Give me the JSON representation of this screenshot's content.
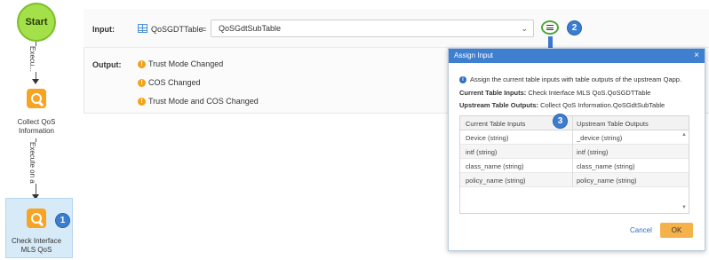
{
  "flow": {
    "start_label": "Start",
    "edge1_label": "Execu...",
    "edge2_label": "Execute on a",
    "node1_label_line1": "Collect QoS",
    "node1_label_line2": "Information",
    "node2_label_line1": "Check Interface",
    "node2_label_line2": "MLS QoS",
    "badge1": "1"
  },
  "panel": {
    "input_label": "Input:",
    "input_var": "QoSGDTTable",
    "equals": "=",
    "input_value": "QoSGdtSubTable",
    "badge2": "2",
    "output_label": "Output:",
    "outputs": [
      "Trust Mode Changed",
      "COS Changed",
      "Trust Mode and COS Changed"
    ]
  },
  "dialog": {
    "title": "Assign Input",
    "close": "×",
    "info_text": "Assign the current table inputs with table outputs of the upstream Qapp.",
    "current_label": "Current Table Inputs:",
    "current_value": "Check Interface MLS QoS.QoSGDTTable",
    "upstream_label": "Upstream Table Outputs:",
    "upstream_value": "Collect QoS Information.QoSGdtSubTable",
    "badge3": "3",
    "col1": "Current Table Inputs",
    "col2": "Upstream Table Outputs",
    "rows": [
      {
        "input": "Device (string)",
        "output": "_device (string)"
      },
      {
        "input": "intf (string)",
        "output": "intf (string)"
      },
      {
        "input": "class_name (string)",
        "output": "class_name (string)"
      },
      {
        "input": "policy_name (string)",
        "output": "policy_name (string)"
      }
    ],
    "cancel": "Cancel",
    "ok": "OK"
  }
}
